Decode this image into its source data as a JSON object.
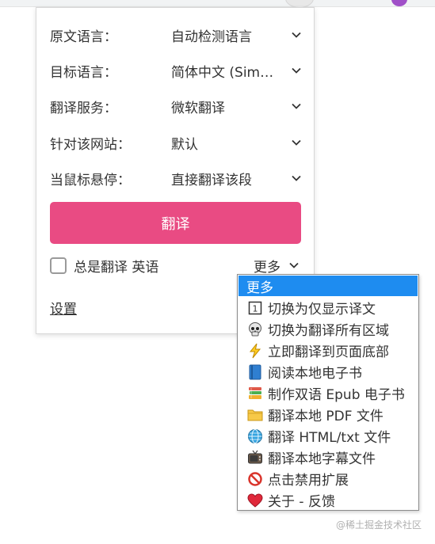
{
  "popup": {
    "rows": [
      {
        "label": "原文语言：",
        "value": "自动检测语言"
      },
      {
        "label": "目标语言：",
        "value": "简体中文 (Simplified Chinese)"
      },
      {
        "label": "翻译服务：",
        "value": "微软翻译"
      },
      {
        "label": "针对该网站：",
        "value": "默认"
      },
      {
        "label": "当鼠标悬停：",
        "value": "直接翻译该段"
      }
    ],
    "translate_button": "翻译",
    "always_translate": "总是翻译 英语",
    "more": "更多",
    "settings": "设置"
  },
  "more_menu": {
    "header": "更多",
    "items": [
      {
        "label": "切换为仅显示译文",
        "icon": "one-box-icon"
      },
      {
        "label": "切换为翻译所有区域",
        "icon": "skull-icon"
      },
      {
        "label": "立即翻译到页面底部",
        "icon": "lightning-icon"
      },
      {
        "label": "阅读本地电子书",
        "icon": "blue-book-icon"
      },
      {
        "label": "制作双语 Epub 电子书",
        "icon": "books-icon"
      },
      {
        "label": "翻译本地 PDF 文件",
        "icon": "folder-icon"
      },
      {
        "label": "翻译 HTML/txt 文件",
        "icon": "globe-icon"
      },
      {
        "label": "翻译本地字幕文件",
        "icon": "tv-icon"
      },
      {
        "label": "点击禁用扩展",
        "icon": "prohibited-icon"
      },
      {
        "label": "关于 - 反馈",
        "icon": "heart-icon"
      }
    ]
  },
  "watermark": "@稀土掘金技术社区",
  "colors": {
    "accent": "#e94b83",
    "menu_highlight": "#1e8cf0"
  }
}
